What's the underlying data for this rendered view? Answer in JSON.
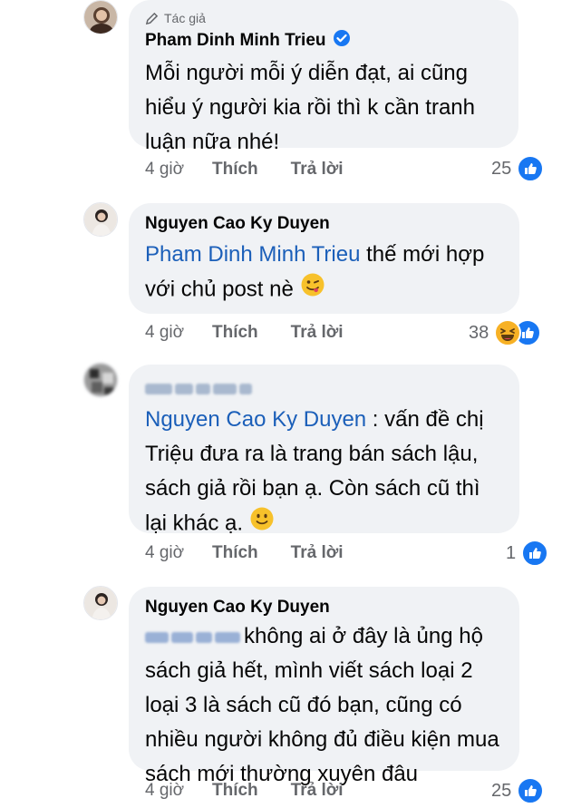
{
  "comments": [
    {
      "badge": "Tác giả",
      "author": "Pham Dinh Minh Trieu",
      "verified": true,
      "lines": [
        "Mỗi người mỗi ý diễn đạt, ai cũng",
        "hiểu ý người kia rồi thì k cần tranh",
        "luận nữa nhé!"
      ],
      "time": "4 giờ",
      "like_label": "Thích",
      "reply_label": "Trả lời",
      "reaction_count": "25",
      "reactions": [
        "like-icon"
      ]
    },
    {
      "author": "Nguyen Cao Ky Duyen",
      "mention": "Pham Dinh Minh Trieu",
      "line1_rest": " thế mới hợp",
      "line2": "với chủ post nè",
      "emoji": "winking-face-tongue",
      "time": "4 giờ",
      "like_label": "Thích",
      "reply_label": "Trả lời",
      "reaction_count": "38",
      "reactions": [
        "haha-icon",
        "like-icon"
      ]
    },
    {
      "author_blurred": true,
      "mention": "Nguyen Cao Ky Duyen",
      "line1_rest": " : vấn đề chị",
      "lines": [
        "Triệu đưa ra là trang bán sách lậu,",
        "sách giả rồi bạn ạ. Còn sách cũ thì"
      ],
      "last_line": "lại khác ạ.",
      "emoji": "slightly-smiling-face",
      "time": "4 giờ",
      "like_label": "Thích",
      "reply_label": "Trả lời",
      "reaction_count": "1",
      "reactions": [
        "like-icon"
      ]
    },
    {
      "author": "Nguyen Cao Ky Duyen",
      "mention_blurred": true,
      "line1_rest": "không ai ở đây là ủng hộ",
      "lines": [
        "sách giả hết, mình viết sách loại 2",
        "loại 3 là sách cũ đó bạn, cũng có",
        "nhiều người không đủ điều kiện mua",
        "sách mới thường xuyên đâu"
      ],
      "time": "4 giờ",
      "like_label": "Thích",
      "reply_label": "Trả lời",
      "reaction_count": "25",
      "reactions": [
        "like-icon"
      ]
    }
  ],
  "colors": {
    "bubble": "#f0f2f5",
    "link": "#1b5fb9",
    "meta": "#65676b",
    "like": "#1877f2"
  }
}
